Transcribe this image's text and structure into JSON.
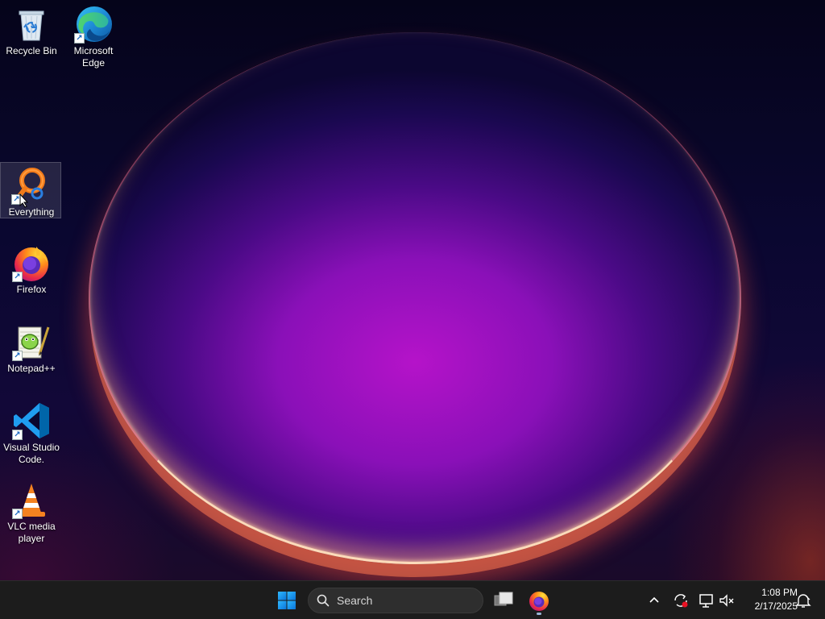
{
  "desktop": {
    "icons": [
      {
        "name": "recycle-bin",
        "label": "Recycle Bin",
        "shortcut": false
      },
      {
        "name": "microsoft-edge",
        "label": "Microsoft Edge",
        "shortcut": true
      },
      {
        "name": "everything",
        "label": "Everything",
        "shortcut": true,
        "selected": true
      },
      {
        "name": "firefox",
        "label": "Firefox",
        "shortcut": true
      },
      {
        "name": "notepad-plus-plus",
        "label": "Notepad++",
        "shortcut": true
      },
      {
        "name": "visual-studio-code",
        "label": "Visual Studio Code.",
        "shortcut": true
      },
      {
        "name": "vlc-media-player",
        "label": "VLC media player",
        "shortcut": true
      }
    ]
  },
  "taskbar": {
    "start_icon": "windows-logo-icon",
    "search": {
      "placeholder": "Search"
    },
    "pinned": [
      {
        "name": "task-view",
        "icon": "task-view-icon"
      },
      {
        "name": "firefox",
        "icon": "firefox-icon",
        "running": true
      }
    ],
    "tray": {
      "overflow_icon": "chevron-up-icon",
      "icons": [
        "sync-icon",
        "network-icon",
        "volume-muted-icon"
      ],
      "time": "1:08 PM",
      "date": "2/17/2025",
      "notification_icon": "notification-bell-icon"
    }
  },
  "colors": {
    "taskbar_bg": "#1c1c1c",
    "accent": "#0078d4"
  }
}
